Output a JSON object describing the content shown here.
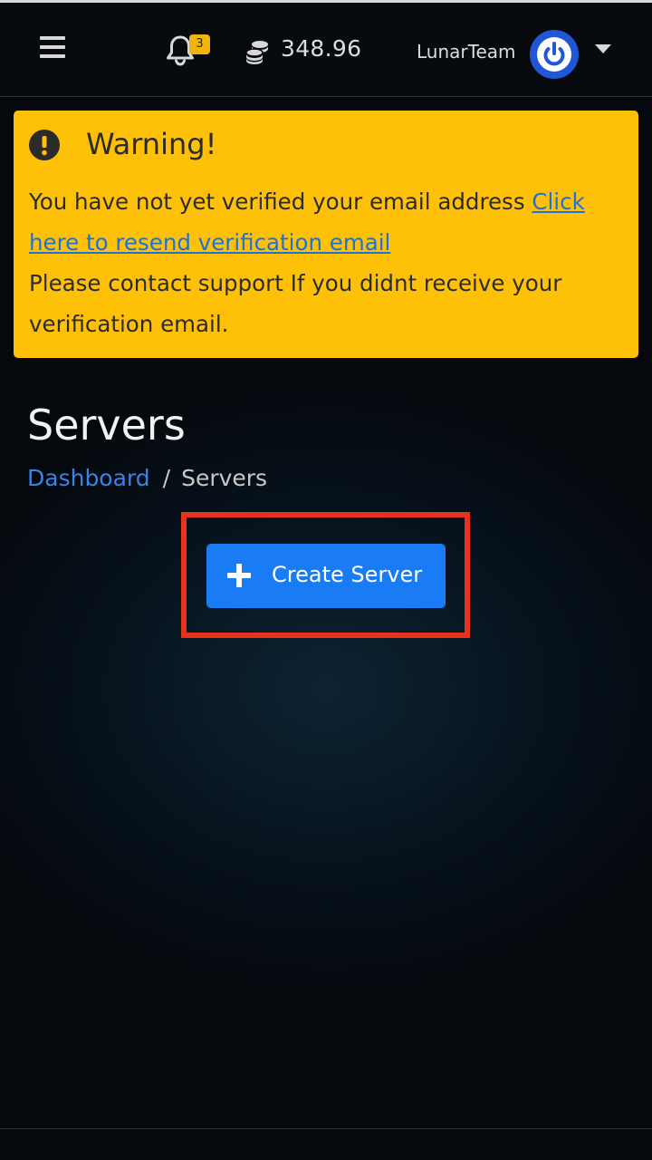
{
  "navbar": {
    "notification_count": "3",
    "balance": "348.96",
    "username": "LunarTeam"
  },
  "alert": {
    "title": "Warning!",
    "message": "You have not yet verified your email address",
    "link_text": "Click here to resend verification email",
    "support_text": "Please contact support If you didnt receive your verification email."
  },
  "page": {
    "title": "Servers"
  },
  "breadcrumb": {
    "items": [
      "Dashboard",
      "Servers"
    ],
    "separator": "/"
  },
  "actions": {
    "create_server_label": "Create Server"
  },
  "colors": {
    "accent": "#1a7cf5",
    "warning": "#ffc107",
    "highlight": "#e8321b",
    "background": "#05080c"
  },
  "icons": {
    "menu": "hamburger-menu-icon",
    "notifications": "bell-icon",
    "balance": "coins-icon",
    "avatar": "power-icon",
    "dropdown": "caret-down-icon",
    "alert": "exclamation-circle-icon",
    "create": "plus-icon"
  }
}
